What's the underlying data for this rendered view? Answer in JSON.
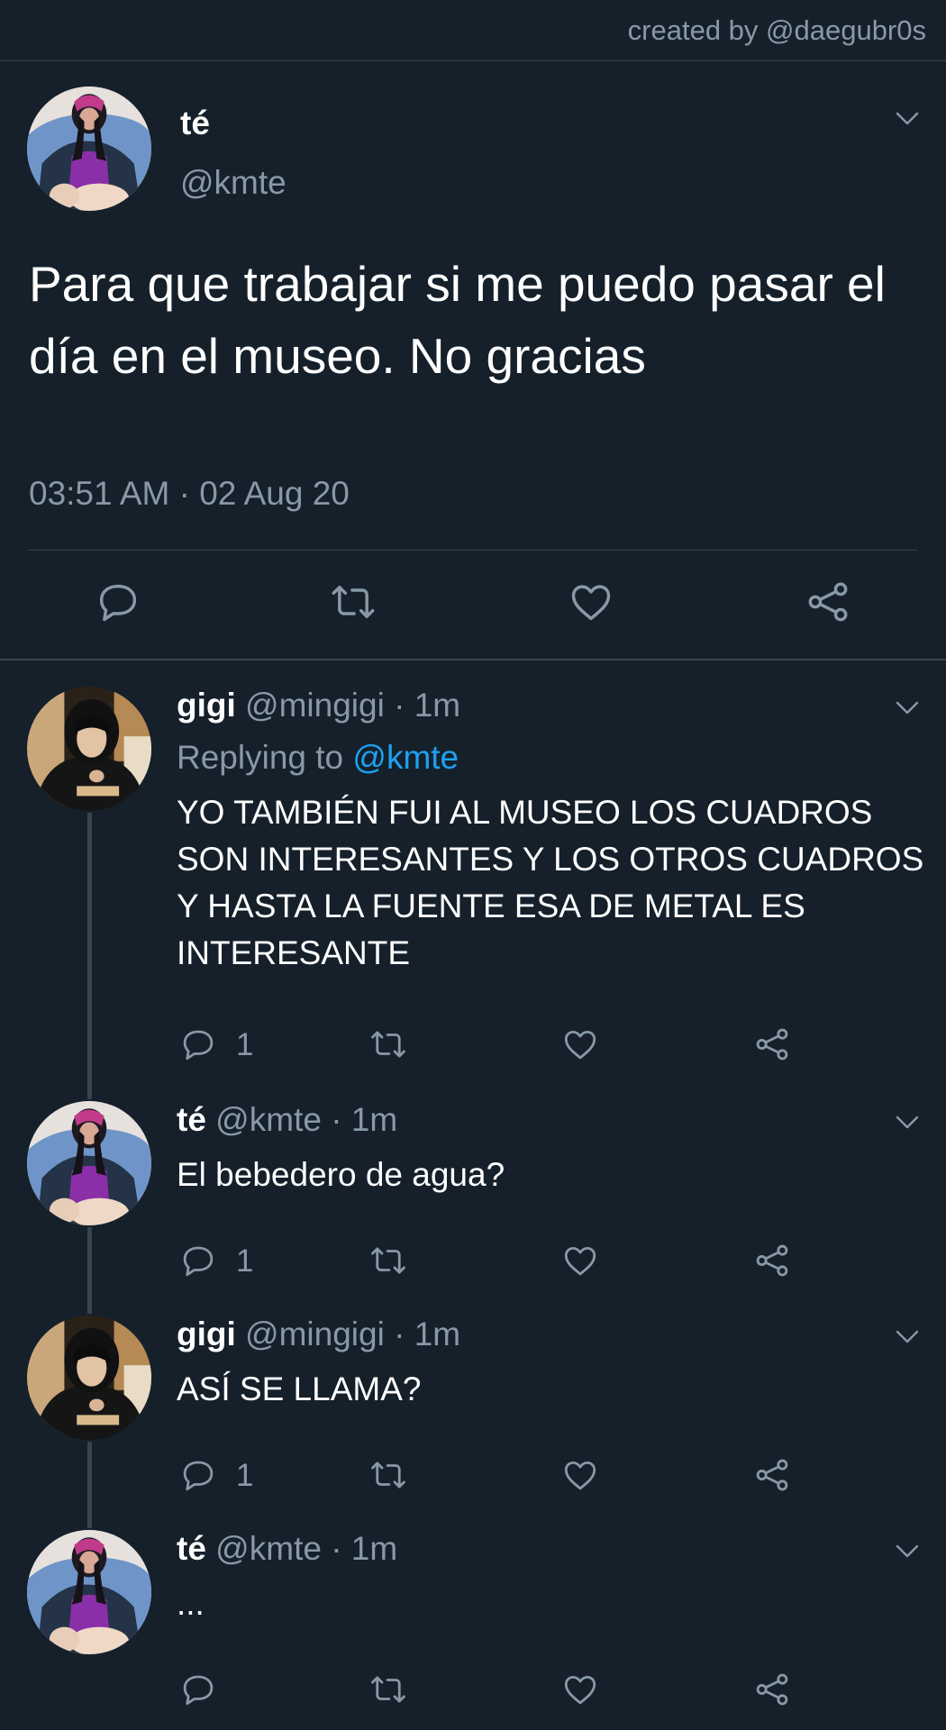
{
  "watermark": "created by @daegubr0s",
  "main_tweet": {
    "name": "té",
    "handle": "@kmte",
    "text": "Para que trabajar si me puedo pasar el día en el museo. No gracias",
    "timestamp": "03:51 AM · 02 Aug 20"
  },
  "replies": [
    {
      "name": "gigi",
      "handle_time": " @mingigi · 1m",
      "replying_label": "Replying to ",
      "replying_to": "@kmte",
      "text": "YO TAMBIÉN FUI AL MUSEO LOS CUADROS SON INTERESANTES Y LOS OTROS CUADROS Y HASTA LA FUENTE ESA DE METAL ES INTERESANTE",
      "reply_count": "1"
    },
    {
      "name": "té",
      "handle_time": " @kmte · 1m",
      "text": "El bebedero de agua?",
      "reply_count": "1"
    },
    {
      "name": "gigi",
      "handle_time": " @mingigi · 1m",
      "text": "ASÍ SE LLAMA?",
      "reply_count": "1"
    },
    {
      "name": "té",
      "handle_time": " @kmte · 1m",
      "text": "...",
      "reply_count": ""
    }
  ],
  "colors": {
    "background": "#15202b",
    "secondary_text": "#8899a6",
    "accent": "#1da1f2",
    "divider": "#38444d"
  },
  "icons": [
    "chevron-down-icon",
    "reply-icon",
    "retweet-icon",
    "like-icon",
    "share-icon"
  ]
}
